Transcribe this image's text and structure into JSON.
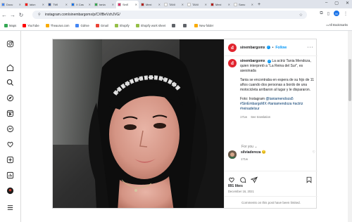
{
  "browser": {
    "tabs": [
      {
        "label": "Docu",
        "color": "#4285f4",
        "active": false
      },
      {
        "label": "lalun",
        "color": "#ff0000",
        "active": false
      },
      {
        "label": "TWI",
        "color": "#3b5998",
        "active": false
      },
      {
        "label": "X Cas",
        "color": "#1a73e8",
        "active": false
      },
      {
        "label": "tania",
        "color": "#34a853",
        "active": false
      },
      {
        "label": "SinE",
        "color": "#e1306c",
        "active": true
      },
      {
        "label": "Mexi",
        "color": "#b31b1b",
        "active": false
      },
      {
        "label": "TANI",
        "color": "#ffffff",
        "active": false
      },
      {
        "label": "TANI",
        "color": "#ffffff",
        "active": false
      },
      {
        "label": "Mexi",
        "color": "#b31b1b",
        "active": false
      },
      {
        "label": "Sanu",
        "color": "#ffffff",
        "active": false
      }
    ],
    "url": "instagram.com/sinembargomx/p/CXfBeVzhJVG/",
    "profile_initial": "M",
    "bookmarks": [
      {
        "label": "Maps",
        "color": "#34a853"
      },
      {
        "label": "YouTube",
        "color": "#ff0000"
      },
      {
        "label": "Theaurus.com",
        "color": "#f9ab00"
      },
      {
        "label": "Gdrive",
        "color": "#4285f4"
      },
      {
        "label": "Gmail",
        "color": "#ea4335"
      },
      {
        "label": "Shopify",
        "color": "#95bf47"
      },
      {
        "label": "Shopify work sheet",
        "color": "#95bf47"
      },
      {
        "label": "",
        "color": "#5f6368"
      },
      {
        "label": "",
        "color": "#5f6368"
      },
      {
        "label": "New folder",
        "color": "#f9ab00"
      }
    ],
    "all_bookmarks": "All Bookmarks"
  },
  "post": {
    "username": "sinembargomx",
    "follow_label": "Follow",
    "avatar_letter": "d",
    "caption_user": "sinembargomx",
    "caption_p1": "La actriz Tania Mendoza, quien interpretó a \"La Reina del Sur\", es asesinada",
    "caption_p2": "Tania se encontraba en espera de su hijo de 11 años cuando dos personas a bordo de una motocicleta arribaron al lugar y le dispararon.",
    "caption_p3_prefix": "Foto: Instagram ",
    "caption_p3_tag": "@taniamendoza5",
    "caption_tags": "#SinEmbargoMX #taniamendoza #actriz #reinadelsur",
    "caption_time": "171w",
    "see_translation": "See translation",
    "for_you": "For you",
    "comment_user": "silviadereza",
    "comment_emoji": "😔",
    "comment_time": "171w",
    "likes": "891 likes",
    "date": "December 16, 2021",
    "limited_text": "Comments on this post have been limited."
  },
  "colors": {
    "ig_blue": "#0095f6",
    "brand_red": "#e1252f"
  }
}
